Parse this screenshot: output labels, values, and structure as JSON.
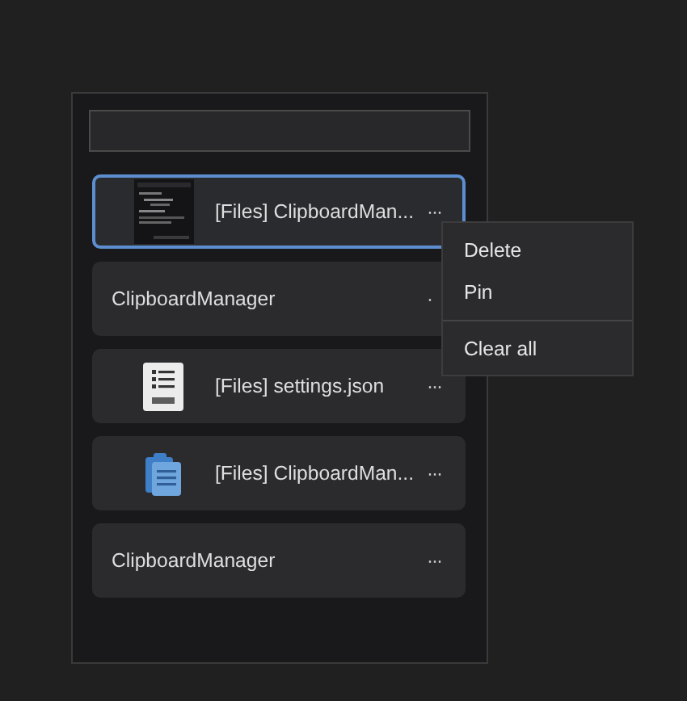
{
  "search": {
    "kind": "field"
  },
  "items": [
    {
      "kind": "picture",
      "text": "[Files] ClipboardMan...",
      "more": "···",
      "selected": true
    },
    {
      "kind": "text",
      "text": "ClipboardManager",
      "more": "·",
      "selected": false
    },
    {
      "kind": "json",
      "text": "[Files] settings.json",
      "more": "···",
      "selected": false
    },
    {
      "kind": "clipboard",
      "text": "[Files] ClipboardMan...",
      "more": "···",
      "selected": false
    },
    {
      "kind": "text",
      "text": "ClipboardManager",
      "more": "···",
      "selected": false
    }
  ],
  "context_menu": {
    "items": [
      {
        "label": "Delete",
        "divider_before": false
      },
      {
        "label": "Pin",
        "divider_before": false
      },
      {
        "label": "Clear all",
        "divider_before": true
      }
    ]
  }
}
